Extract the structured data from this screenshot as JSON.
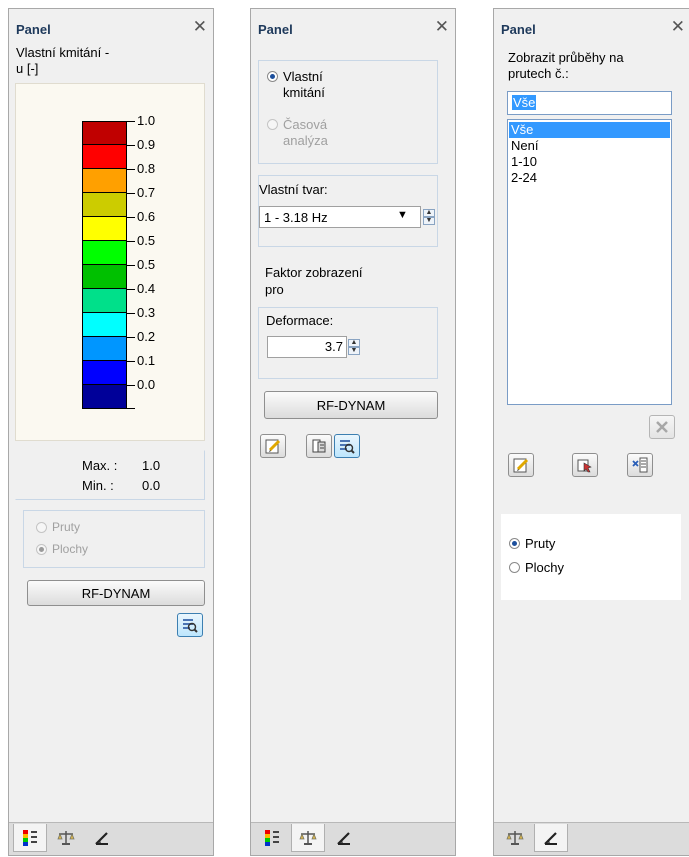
{
  "panel1": {
    "title": "Panel",
    "caption_line1": "Vlastní kmitání -",
    "caption_line2": "u [-]",
    "scale": [
      {
        "label": "1.0",
        "color": "#c00000"
      },
      {
        "label": "0.9",
        "color": "#ff0000"
      },
      {
        "label": "0.8",
        "color": "#ffa000"
      },
      {
        "label": "0.7",
        "color": "#cccc00"
      },
      {
        "label": "0.6",
        "color": "#ffff00"
      },
      {
        "label": "0.5",
        "color": "#00ff00"
      },
      {
        "label": "0.5",
        "color": "#00c000"
      },
      {
        "label": "0.4",
        "color": "#00e08a"
      },
      {
        "label": "0.3",
        "color": "#00ffff"
      },
      {
        "label": "0.2",
        "color": "#0096ff"
      },
      {
        "label": "0.1",
        "color": "#0000ff"
      },
      {
        "label": "0.0",
        "color": "#000099"
      }
    ],
    "max_label": "Max. :",
    "max_value": "1.0",
    "min_label": "Min. :",
    "min_value": "0.0",
    "radio_pruty": "Pruty",
    "radio_plochy": "Plochy",
    "rf_button": "RF-DYNAM"
  },
  "panel2": {
    "title": "Panel",
    "radio_vlastni_1": "Vlastní",
    "radio_vlastni_2": "kmitání",
    "radio_casova_1": "Časová",
    "radio_casova_2": "analýza",
    "vlastni_tvar_label": "Vlastní tvar:",
    "vlastni_tvar_value": "1 - 3.18 Hz",
    "faktor_line1": "Faktor zobrazení",
    "faktor_line2": "pro",
    "deformace_label": "Deformace:",
    "deformace_value": "3.7",
    "rf_button": "RF-DYNAM"
  },
  "panel3": {
    "title": "Panel",
    "caption_line1": "Zobrazit průběhy na",
    "caption_line2": "prutech č.:",
    "input_value": "Vše",
    "list_items": [
      "Vše",
      "Není",
      "1-10",
      "2-24"
    ],
    "radio_pruty": "Pruty",
    "radio_plochy": "Plochy"
  },
  "close_glyph": "✕"
}
